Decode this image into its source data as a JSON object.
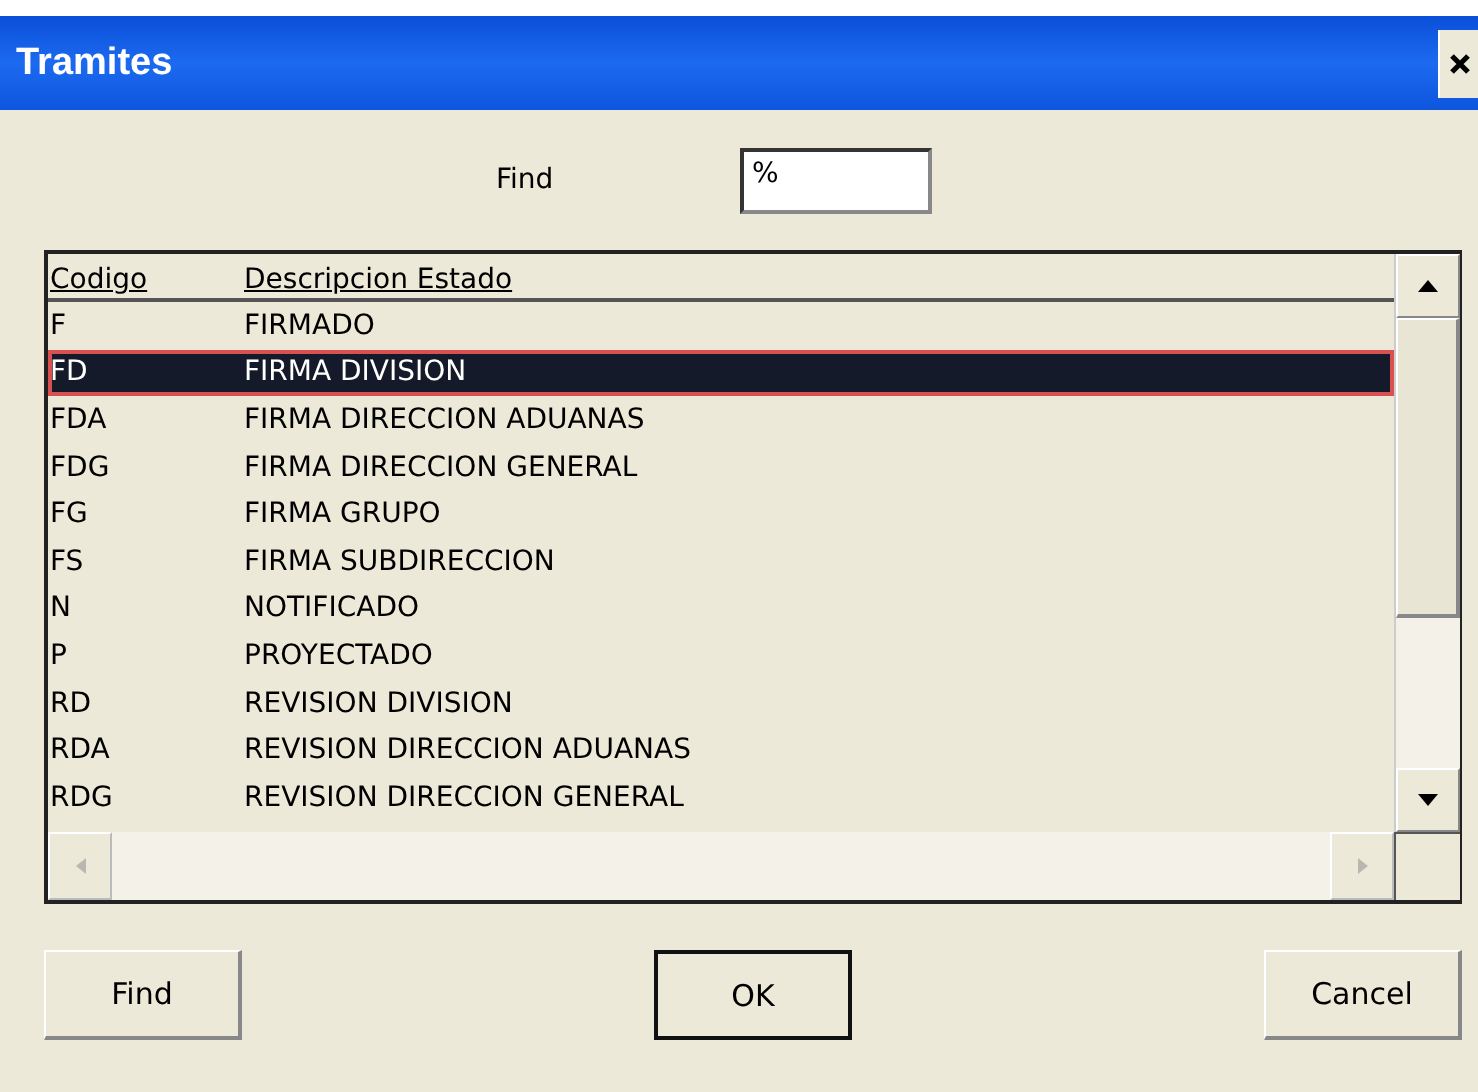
{
  "window": {
    "title": "Tramites"
  },
  "search": {
    "label": "Find",
    "value": "%"
  },
  "table": {
    "columns": [
      "Codigo",
      "Descripcion Estado"
    ],
    "rows": [
      {
        "code": "F",
        "description": "FIRMADO",
        "selected": false
      },
      {
        "code": "FD",
        "description": "FIRMA DIVISION",
        "selected": true
      },
      {
        "code": "FDA",
        "description": "FIRMA DIRECCION ADUANAS",
        "selected": false
      },
      {
        "code": "FDG",
        "description": "FIRMA DIRECCION GENERAL",
        "selected": false
      },
      {
        "code": "FG",
        "description": "FIRMA GRUPO",
        "selected": false
      },
      {
        "code": "FS",
        "description": "FIRMA SUBDIRECCION",
        "selected": false
      },
      {
        "code": "N",
        "description": "NOTIFICADO",
        "selected": false
      },
      {
        "code": "P",
        "description": "PROYECTADO",
        "selected": false
      },
      {
        "code": "RD",
        "description": "REVISION DIVISION",
        "selected": false
      },
      {
        "code": "RDA",
        "description": "REVISION DIRECCION ADUANAS",
        "selected": false
      },
      {
        "code": "RDG",
        "description": "REVISION DIRECCION GENERAL",
        "selected": false
      }
    ]
  },
  "buttons": [
    {
      "label": "Find",
      "kind": "normal"
    },
    {
      "label": "OK",
      "kind": "default"
    },
    {
      "label": "Cancel",
      "kind": "normal"
    }
  ]
}
